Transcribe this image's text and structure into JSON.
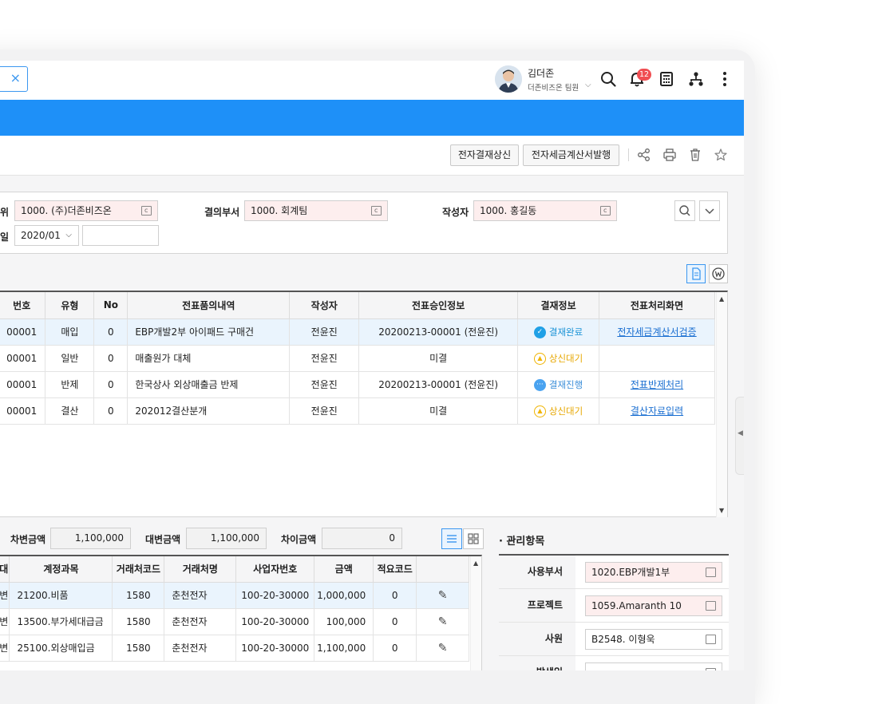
{
  "header": {
    "tab_close": "×",
    "user_name": "김더존",
    "user_dept": "더존비즈온 팀원",
    "notification_count": "12"
  },
  "actions": {
    "approve_btn": "전자결재상신",
    "invoice_btn": "전자세금계산서발행"
  },
  "search": {
    "unit_label_partial": "위",
    "unit_value": "1000. (주)더존비즈온",
    "dept_label": "결의부서",
    "dept_value": "1000. 회계팀",
    "writer_label": "작성자",
    "writer_value": "1000. 홍길동",
    "date_label_partial": "일",
    "date_value": "2020/01",
    "date_extra": ""
  },
  "main_table": {
    "columns": [
      "번호",
      "유형",
      "No",
      "전표품의내역",
      "작성자",
      "전표승인정보",
      "결재정보",
      "전표처리화면"
    ],
    "rows": [
      {
        "num": "00001",
        "type": "매입",
        "no": "0",
        "desc": "EBP개발2부 아이패드 구매건",
        "writer": "전윤진",
        "approval": "20200213-00001 (전윤진)",
        "status": "결재완료",
        "status_kind": "done",
        "action": "전자세금계산서검증"
      },
      {
        "num": "00001",
        "type": "일반",
        "no": "0",
        "desc": "매출원가 대체",
        "writer": "전윤진",
        "approval": "미결",
        "status": "상신대기",
        "status_kind": "wait",
        "action": ""
      },
      {
        "num": "00001",
        "type": "반제",
        "no": "0",
        "desc": "한국상사 외상매출금 반제",
        "writer": "전윤진",
        "approval": "20200213-00001 (전윤진)",
        "status": "결재진행",
        "status_kind": "prog",
        "action": "전표반제처리"
      },
      {
        "num": "00001",
        "type": "결산",
        "no": "0",
        "desc": "202012결산분개",
        "writer": "전윤진",
        "approval": "미결",
        "status": "상신대기",
        "status_kind": "wait",
        "action": "결산자료입력"
      }
    ]
  },
  "totals": {
    "debit_label": "차변금액",
    "debit_value": "1,100,000",
    "credit_label": "대변금액",
    "credit_value": "1,100,000",
    "diff_label": "차이금액",
    "diff_value": "0"
  },
  "bottom_table": {
    "columns": [
      "대",
      "계정과목",
      "거래처코드",
      "거래처명",
      "사업자번호",
      "금액",
      "적요코드",
      ""
    ],
    "rows": [
      {
        "dc": "변",
        "account": "21200.비품",
        "code": "1580",
        "name": "춘천전자",
        "biz": "100-20-30000",
        "amount": "1,000,000",
        "memo": "0"
      },
      {
        "dc": "변",
        "account": "13500.부가세대급금",
        "code": "1580",
        "name": "춘천전자",
        "biz": "100-20-30000",
        "amount": "100,000",
        "memo": "0"
      },
      {
        "dc": "변",
        "account": "25100.외상매입금",
        "code": "1580",
        "name": "춘천전자",
        "biz": "100-20-30000",
        "amount": "1,100,000",
        "memo": "0"
      }
    ]
  },
  "management": {
    "title": "· 관리항목",
    "rows": [
      {
        "label": "사용부서",
        "value": "1020.EBP개발1부",
        "pink": true
      },
      {
        "label": "프로젝트",
        "value": "1059.Amaranth 10",
        "pink": true
      },
      {
        "label": "사원",
        "value": "B2548. 이형욱",
        "pink": false
      },
      {
        "label": "발생일",
        "value": "",
        "pink": false
      }
    ]
  },
  "colors": {
    "accent": "#1e90f8",
    "link": "#1b6fd1",
    "badge": "#f04e52"
  }
}
